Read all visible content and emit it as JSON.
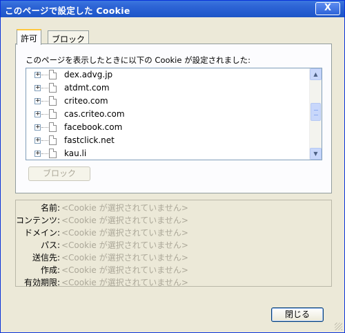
{
  "window": {
    "title": "このページで設定した Cookie",
    "close_glyph": "X"
  },
  "tabs": [
    {
      "label": "許可"
    },
    {
      "label": "ブロック"
    }
  ],
  "panel": {
    "caption": "このページを表示したときに以下の Cookie が設定されました:",
    "items": [
      {
        "expander": "+",
        "label": "dex.advg.jp"
      },
      {
        "expander": "+",
        "label": "atdmt.com"
      },
      {
        "expander": "+",
        "label": "criteo.com"
      },
      {
        "expander": "+",
        "label": "cas.criteo.com"
      },
      {
        "expander": "+",
        "label": "facebook.com"
      },
      {
        "expander": "+",
        "label": "fastclick.net"
      },
      {
        "expander": "+",
        "label": "kau.li"
      }
    ],
    "block_button": "ブロック",
    "scroll": {
      "up_glyph": "▲",
      "down_glyph": "▼"
    }
  },
  "details": [
    {
      "label": "名前:",
      "value": "<Cookie が選択されていません>"
    },
    {
      "label": "コンテンツ:",
      "value": "<Cookie が選択されていません>"
    },
    {
      "label": "ドメイン:",
      "value": "<Cookie が選択されていません>"
    },
    {
      "label": "パス:",
      "value": "<Cookie が選択されていません>"
    },
    {
      "label": "送信先:",
      "value": "<Cookie が選択されていません>"
    },
    {
      "label": "作成:",
      "value": "<Cookie が選択されていません>"
    },
    {
      "label": "有効期限:",
      "value": "<Cookie が選択されていません>"
    }
  ],
  "buttons": {
    "close": "閉じる"
  },
  "colors": {
    "title_bar": "#245ccf",
    "dialog_bg": "#ece9d8",
    "tab_accent": "#ffc83c",
    "disabled_text": "#aca899"
  }
}
